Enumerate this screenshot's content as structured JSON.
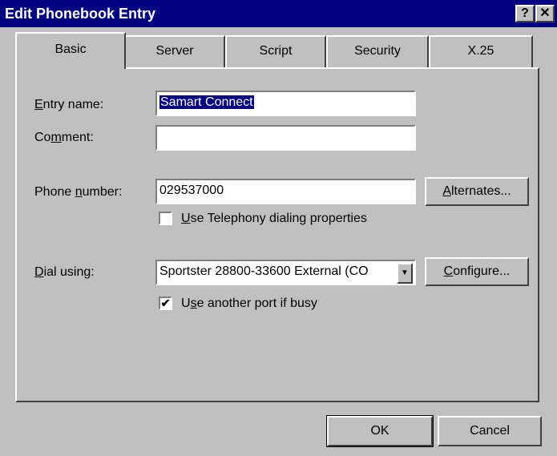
{
  "window": {
    "title": "Edit Phonebook Entry",
    "help_label": "?",
    "close_label": "✕"
  },
  "tabs": [
    "Basic",
    "Server",
    "Script",
    "Security",
    "X.25"
  ],
  "form": {
    "entry_name": {
      "label_pre": "",
      "label_u": "E",
      "label_post": "ntry name:",
      "value": "Samart Connect"
    },
    "comment": {
      "label_pre": "Co",
      "label_u": "m",
      "label_post": "ment:",
      "value": ""
    },
    "phone_number": {
      "label_pre": "Phone ",
      "label_u": "n",
      "label_post": "umber:",
      "value": "029537000"
    },
    "alternates_button": {
      "pre": "",
      "u": "A",
      "post": "lternates..."
    },
    "use_telephony": {
      "pre": "",
      "u": "U",
      "post": "se Telephony dialing properties",
      "checked": false
    },
    "dial_using": {
      "label_pre": "",
      "label_u": "D",
      "label_post": "ial using:",
      "value": "Sportster 28800-33600 External (CO"
    },
    "configure_button": {
      "pre": "",
      "u": "C",
      "post": "onfigure..."
    },
    "use_another_port": {
      "pre": "U",
      "u": "s",
      "post": "e another port if busy",
      "checked": true
    }
  },
  "buttons": {
    "ok": "OK",
    "cancel": "Cancel"
  }
}
